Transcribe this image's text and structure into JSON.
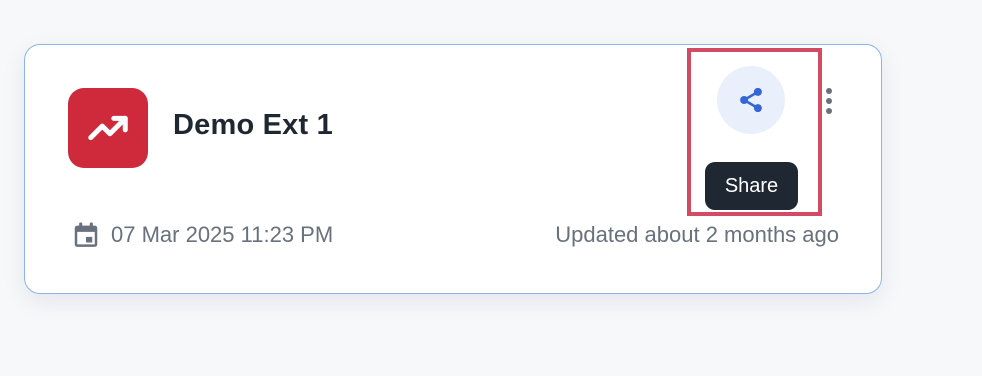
{
  "card": {
    "title": "Demo Ext 1",
    "app_icon": "trending-up-icon",
    "app_icon_color": "#cf2a3c",
    "date": "07 Mar 2025 11:23 PM",
    "date_icon": "calendar-icon",
    "updated": "Updated about 2 months ago"
  },
  "actions": {
    "share_icon": "share-icon",
    "share_tooltip": "Share",
    "menu_icon": "more-vertical-icon"
  },
  "colors": {
    "card_border": "#8bb4ee",
    "share_bg": "#eaf0fb",
    "share_icon": "#3566d6",
    "tooltip_bg": "#1f2733",
    "highlight": "#d24b63",
    "text_primary": "#1f2733",
    "text_muted": "#68717d"
  }
}
